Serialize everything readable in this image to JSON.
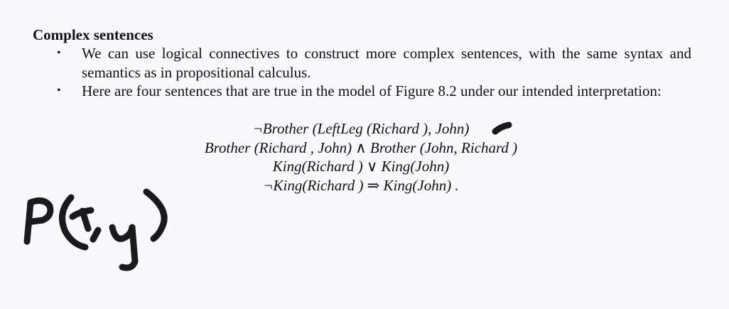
{
  "heading": "Complex sentences",
  "bullets": [
    {
      "symbol": "•",
      "text": "We can use logical connectives to construct more complex sentences, with the same syntax and semantics as in propositional calculus."
    },
    {
      "symbol": "•",
      "text": "Here are four sentences that are true in the model of Figure 8.2 under our intended interpretation:"
    }
  ],
  "formulas": [
    "¬Brother (LeftLeg (Richard ), John)",
    "Brother (Richard , John) ∧ Brother (John, Richard )",
    "King(Richard ) ∨ King(John)",
    "¬King(Richard ) ⇒ King(John) ."
  ],
  "handwriting": {
    "text": "P(x,y)",
    "ink_color": "#1a1a1a"
  }
}
